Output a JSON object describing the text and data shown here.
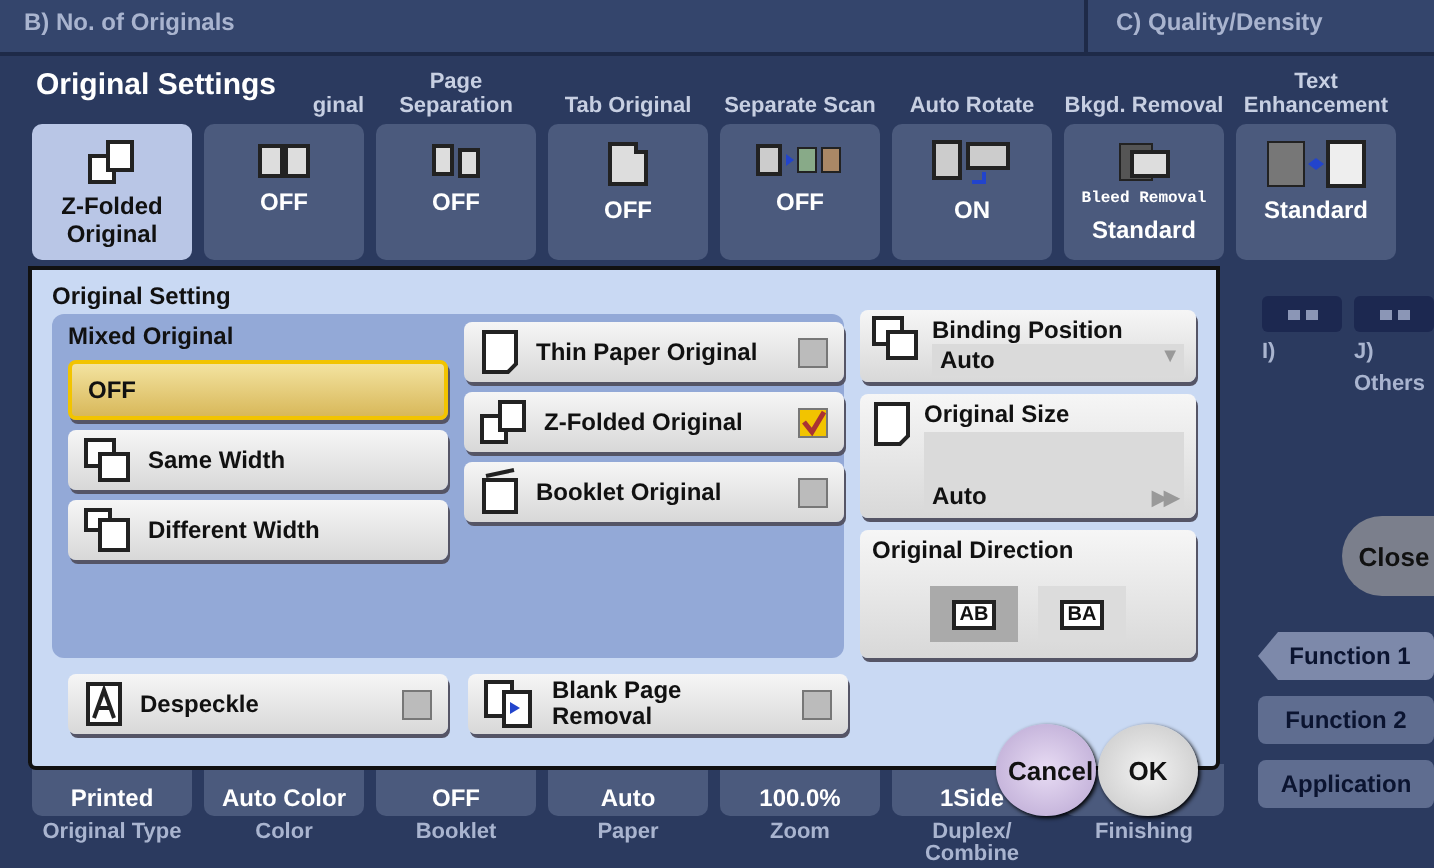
{
  "sections": [
    {
      "label": "B)  No. of Originals"
    },
    {
      "label": "C)  Quality/Density"
    }
  ],
  "title": "Original Settings",
  "top_tiles": [
    {
      "value": "Z-Folded Original",
      "selected": true
    },
    {
      "header": "ginal",
      "value": "OFF",
      "selected": false
    },
    {
      "header": "Page Separation",
      "value": "OFF",
      "selected": false
    },
    {
      "header": "Tab Original",
      "value": "OFF",
      "selected": false
    },
    {
      "header": "Separate Scan",
      "value": "OFF",
      "selected": false
    },
    {
      "header": "Auto Rotate",
      "value": "ON",
      "selected": false
    },
    {
      "header": "Bkgd. Removal",
      "note": "Bleed Removal",
      "value": "Standard",
      "selected": false
    },
    {
      "header": "Text Enhancement",
      "value": "Standard",
      "selected": false
    }
  ],
  "dialog": {
    "setting_label": "Original Setting",
    "mixed_original": {
      "label": "Mixed Original",
      "options": [
        {
          "label": "OFF",
          "selected": true
        },
        {
          "label": "Same Width",
          "selected": false
        },
        {
          "label": "Different Width",
          "selected": false
        }
      ]
    },
    "checks": [
      {
        "label": "Thin Paper Original",
        "checked": false
      },
      {
        "label": "Z-Folded Original",
        "checked": true
      },
      {
        "label": "Booklet Original",
        "checked": false
      }
    ],
    "binding_position": {
      "label": "Binding Position",
      "value": "Auto",
      "arrow": "▼"
    },
    "original_size": {
      "label": "Original Size",
      "value": "Auto",
      "arrow": "▶▶"
    },
    "original_direction": {
      "label": "Original Direction",
      "options": [
        {
          "label": "AB",
          "selected": true
        },
        {
          "label": "BA",
          "selected": false
        }
      ]
    },
    "bottom_checks": [
      {
        "label": "Despeckle",
        "checked": false
      },
      {
        "label": "Blank Page Removal",
        "checked": false
      }
    ],
    "buttons": [
      {
        "label": "Cancel",
        "kind": "cancel"
      },
      {
        "label": "OK",
        "kind": "ok"
      }
    ]
  },
  "side_buttons": [
    {
      "label": "I)"
    },
    {
      "label": "J)",
      "caption": "Others"
    }
  ],
  "close": "Close",
  "function_tabs": [
    {
      "label": "Function 1",
      "selected": true
    },
    {
      "label": "Function 2",
      "selected": false
    },
    {
      "label": "Application",
      "selected": false
    }
  ],
  "bottom_tiles": [
    {
      "value": "Printed",
      "label": "Original Type"
    },
    {
      "value": "Auto Color",
      "label": "Color"
    },
    {
      "value": "OFF",
      "label": "Booklet"
    },
    {
      "value": "Auto",
      "label": "Paper"
    },
    {
      "value": "100.0%",
      "label": "Zoom"
    },
    {
      "value": "1Side",
      "label": "Duplex/ Combine"
    },
    {
      "label": "Finishing"
    }
  ]
}
